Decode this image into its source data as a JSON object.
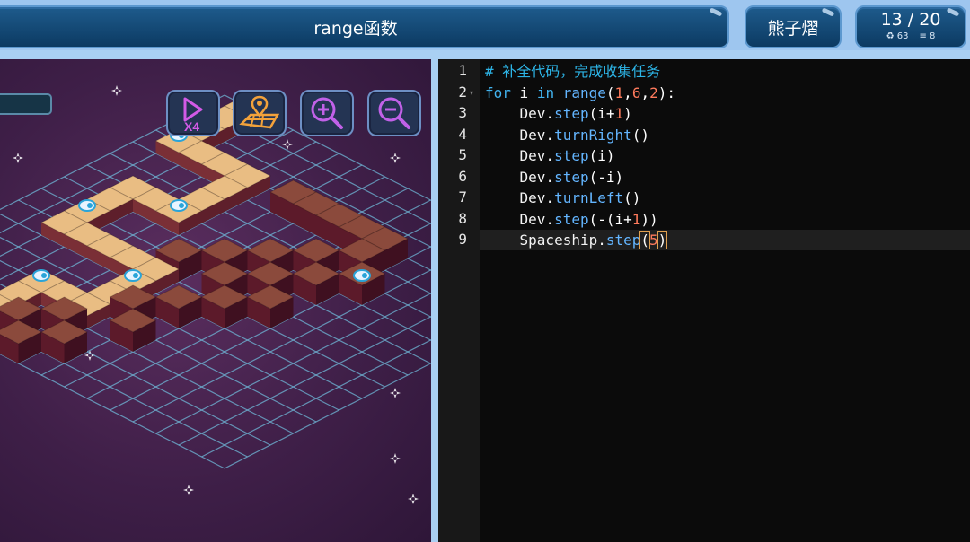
{
  "header": {
    "title": "range函数",
    "user_name": "熊子熠",
    "progress": "13 / 20",
    "score_icon": "trophy-icon",
    "score": "63",
    "lines_icon": "menu-lines-icon",
    "lines": "8"
  },
  "game": {
    "toolbar": [
      {
        "name": "speed-x4-button",
        "icon": "play-x4-icon",
        "label": "X4"
      },
      {
        "name": "map-location-button",
        "icon": "map-pin-icon"
      },
      {
        "name": "zoom-in-button",
        "icon": "zoom-in-icon"
      },
      {
        "name": "zoom-out-button",
        "icon": "zoom-out-icon"
      }
    ]
  },
  "editor": {
    "lines": [
      {
        "n": "1",
        "fold": "",
        "tokens": [
          [
            "c-cm",
            "# 补全代码，完成收集任务"
          ]
        ]
      },
      {
        "n": "2",
        "fold": "▾",
        "tokens": [
          [
            "c-kw",
            "for"
          ],
          [
            "",
            " i "
          ],
          [
            "c-kw",
            "in"
          ],
          [
            "",
            " "
          ],
          [
            "c-fn",
            "range"
          ],
          [
            "c-op",
            "("
          ],
          [
            "c-num",
            "1"
          ],
          [
            "c-op",
            ","
          ],
          [
            "c-num",
            "6"
          ],
          [
            "c-op",
            ","
          ],
          [
            "c-num",
            "2"
          ],
          [
            "c-op",
            "):"
          ]
        ]
      },
      {
        "n": "3",
        "fold": "",
        "tokens": [
          [
            "",
            "    Dev."
          ],
          [
            "c-fn",
            "step"
          ],
          [
            "c-op",
            "(i"
          ],
          [
            "c-op",
            "+"
          ],
          [
            "c-num",
            "1"
          ],
          [
            "c-op",
            ")"
          ]
        ]
      },
      {
        "n": "4",
        "fold": "",
        "tokens": [
          [
            "",
            "    Dev."
          ],
          [
            "c-fn",
            "turnRight"
          ],
          [
            "c-op",
            "()"
          ]
        ]
      },
      {
        "n": "5",
        "fold": "",
        "tokens": [
          [
            "",
            "    Dev."
          ],
          [
            "c-fn",
            "step"
          ],
          [
            "c-op",
            "(i)"
          ]
        ]
      },
      {
        "n": "6",
        "fold": "",
        "tokens": [
          [
            "",
            "    Dev."
          ],
          [
            "c-fn",
            "step"
          ],
          [
            "c-op",
            "(-i)"
          ]
        ]
      },
      {
        "n": "7",
        "fold": "",
        "tokens": [
          [
            "",
            "    Dev."
          ],
          [
            "c-fn",
            "turnLeft"
          ],
          [
            "c-op",
            "()"
          ]
        ]
      },
      {
        "n": "8",
        "fold": "",
        "tokens": [
          [
            "",
            "    Dev."
          ],
          [
            "c-fn",
            "step"
          ],
          [
            "c-op",
            "(-(i+"
          ],
          [
            "c-num",
            "1"
          ],
          [
            "c-op",
            "))"
          ]
        ]
      },
      {
        "n": "9",
        "fold": "",
        "tokens": [
          [
            "",
            "    Spaceship."
          ],
          [
            "c-fn",
            "step"
          ],
          [
            "cursor-box c-op",
            "("
          ],
          [
            "c-num",
            "5"
          ],
          [
            "cursor-box c-op",
            ")"
          ]
        ]
      }
    ],
    "current_line": "9"
  },
  "colors": {
    "header_bg": "#0c3a62",
    "space_bg": "#3f1f48",
    "grid": "#6fb8d8",
    "path_tile": "#e9bd83",
    "block": "#8b4a3c",
    "editor_bg": "#0b0b0b",
    "comment": "#2db4e6",
    "number": "#ff7a5c"
  }
}
